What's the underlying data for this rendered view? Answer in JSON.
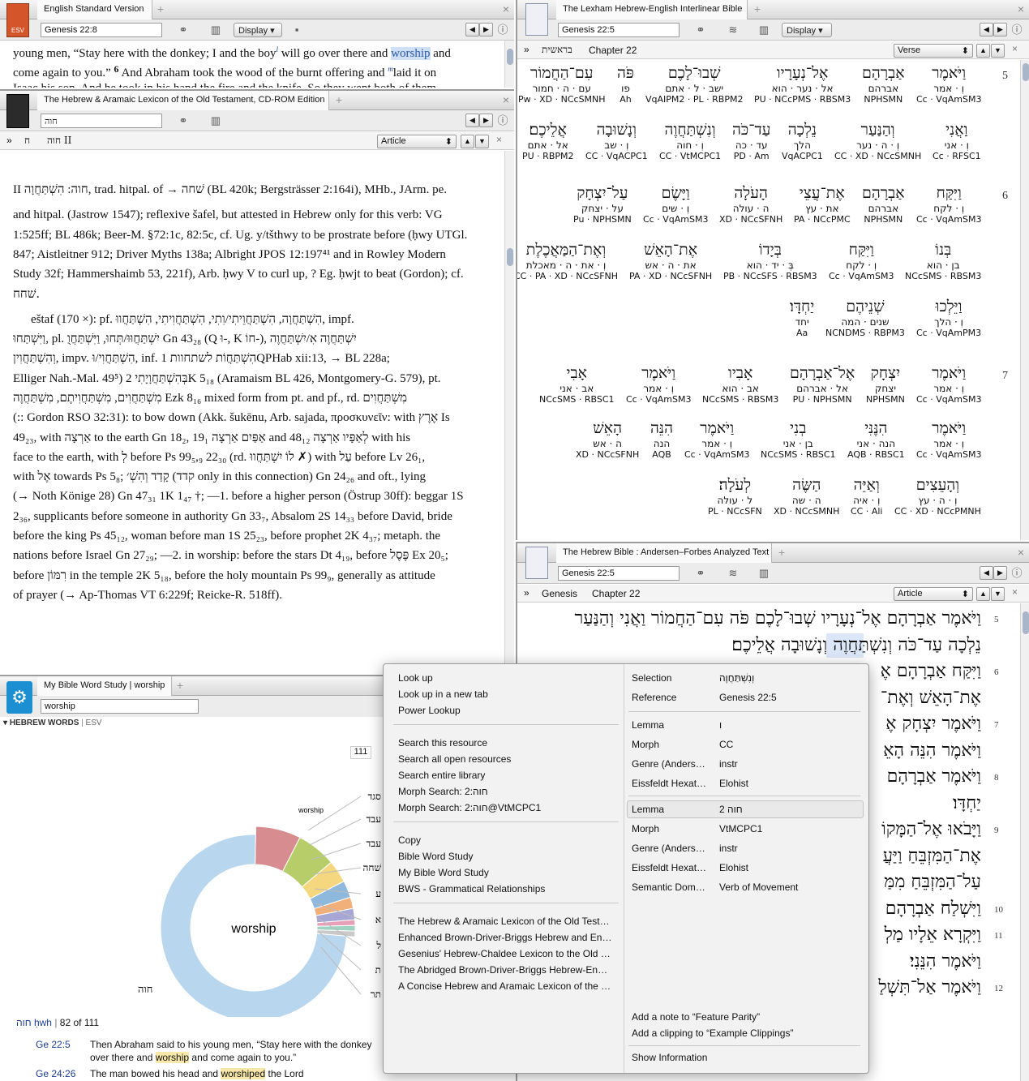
{
  "esv": {
    "tab": "English Standard Version",
    "ref": "Genesis 22:8",
    "display": "Display",
    "icon": "esv-logo-icon",
    "text1": "young men, “Stay here with the donkey; I and the boy",
    "sup_l": "l",
    "text1b": " will go over there and ",
    "hl": "worship",
    "text1c": " and",
    "text2": "come again to you.” ",
    "vn6": "6",
    "text2b": " And Abraham took the wood of the burnt offering and ",
    "sup_m": "m",
    "text2c": "laid it on",
    "text3": "Isaac his son. And he took in his hand the fire and the knife. So they went both of them"
  },
  "halot": {
    "tab": "The Hebrew & Aramaic Lexicon of the Old Testament, CD-ROM Edition",
    "search": "חוה",
    "nav1": "ח",
    "nav2": "חוה II",
    "sel": "Article",
    "lines": [
      "II חוה: הִשְׁתַּחֲוָה, trad. hitpal. of → שׁחה (BL 420k; Bergsträsser 2:164i), MHb., JArm. pe.",
      "and hitpal. (Jastrow 1547); reflexive šafel, but attested in Hebrew only for this verb: VG",
      "1:525ff; BL 486k; Beer-M. §72:1c, 82:5c, cf. Ug. y/tšthwy to be prostrate before (ḥwy UTGl.",
      "847; Aistleitner 912; Driver Myths 138a; Albright JPOS 12:197⁴¹ and in Rowley Modern",
      "Study 32f; Hammershaimb 53, 221f), Arb. ḥwy V to curl up, ? Eg. ḥwjt to beat (Gordon); cf.",
      "שׁחח.",
      "eštaf (170 ×): pf. הִשְׁתַּחֲוָה, הִשְׁתַּחֲוֵיתִי/וִתִי, הִשְׁתַּחֲוִיתִי, הִשְׁתַּחֲווּ, impf.",
      "וַיִּשְׁתַּחוּ, pl. יִשְׁתַּחֲוּוּ/תְּחוּ, וַיִּשְׁתַּחֲוֻ Gn 43₂₈ (Q וּ-, K חוֹ-), יִשְׁתַּחֲוֶה אִ/יִשְׁתַּחֲוֶה",
      "וְהִשְׁתַּחֲוִין, impv. הִשְׁתַּחֲוִי/וּ, inf. הִשְׁתַּחֲוֹת לשתחוות 1QPHab xii:13, → BL 228a;",
      "Elliger Nah.-Mal. 49⁵) בְּהִשְׁתַּחֲוָיָתִי 2K 5₁₈ (Aramaism BL 426, Montgomery-G. 579), pt.",
      "מִשְׁתַּחֲוִים, מִשְׁתַּחֲוִיתֶם, מִשְׁתַּחֲוֶה Ezk 8₁₆ mixed form from pt. and pf., rd. מִשְׁתַּחֲוִים",
      "(:: Gordon RSO 32:31): to bow down (Akk. šukēnu, Arb. sajada, προσκυνεῖν: with אֶרֶץ Is",
      "49₂₃, with אַרְצָה to the earth Gn 18₂, אַפַּיִם אַרְצָה 19₁ and לְאַפָּיו אַרְצָה 48₁₂ with his",
      "face to the earth, with לְ before Ps 99₅,₉ 22₃₀ (rd. לוֹ יִשְׁתַּחֲווּ ✗) with עַל before Lv 26₁,",
      "with אֶל towards Ps 5₈; קדד) קָדַד וְהִשְׁ׳ only in this connection) Gn 24₂₆ and oft., lying",
      "(→ Noth Könige 28) Gn 47₃₁ 1K 1₄₇ †; —1. before a higher person (Östrup 30ff): beggar 1S",
      "2₃₆, supplicants before someone in authority Gn 33₇, Absalom 2S 14₃₃ before David, bride",
      "before the king Ps 45₁₂, woman before man 1S 25₂₃, before prophet 2K 4₃₇; metaph. the",
      "nations before Israel Gn 27₂₉; —2. in worship: before the stars Dt 4₁₉, before פֶּסֶל Ex 20₅;",
      "before רִמּוֹן in the temple 2K 5₁₈, before the holy mountain Ps 99₉, generally as attitude",
      "of prayer (→ Ap-Thomas VT 6:229f; Reicke-R. 518ff)."
    ]
  },
  "lhi": {
    "tab": "The Lexham Hebrew-English Interlinear Bible",
    "ref": "Genesis 22:5",
    "display": "Display",
    "nav1": "בראשית",
    "nav2": "Chapter 22",
    "sel": "Verse",
    "rows": [
      {
        "v": "5",
        "words": [
          [
            "וַיֹּאמֶר",
            "וְ · אמר",
            "Cc · VqAmSM3"
          ],
          [
            "אַבְרָהָם",
            "אברהם",
            "NPHSMN"
          ],
          [
            "אֶל־נְעָרָיו",
            "אל · נער · הוא",
            "PU · NCcPMS · RBSM3"
          ],
          [
            "שְׁבוּ־לָכֶם",
            "ישב · ל · אתם",
            "VqAIPM2 · PL · RBPM2"
          ],
          [
            "פֹּה",
            "פו",
            "Ah"
          ],
          [
            "עִם־הַחֲמוֹר",
            "עם · ה · חמור",
            "Pw · XD · NCcSMNH"
          ]
        ]
      },
      {
        "v": "",
        "words": [
          [
            "וַאֲנִי",
            "וְ · אני",
            "Cc · RFSC1"
          ],
          [
            "וְהַנַּעַר",
            "וְ · ה · נער",
            "CC · XD · NCcSMNH"
          ],
          [
            "נֵלְכָה",
            "הלך",
            "VqACPC1"
          ],
          [
            "עַד־כֹּה",
            "עד · כה",
            "PD · Am"
          ],
          [
            "וְנִשְׁתַּחֲוֶה",
            "וְ · חוה",
            "CC · VtMCPC1"
          ],
          [
            "וְנָשׁוּבָה",
            "וְ · שב",
            "CC · VqACPC1"
          ],
          [
            "אֲלֵיכֶם׃",
            "אל · אתם",
            "PU · RBPM2"
          ]
        ]
      },
      {
        "v": "6",
        "words": [
          [
            "וַיִּקַּח",
            "וְ · לקח",
            "Cc · VqAmSM3"
          ],
          [
            "אַבְרָהָם",
            "אברהם",
            "NPHSMN"
          ],
          [
            "אֶת־עֲצֵי",
            "את · עץ",
            "PA · NCcPMC"
          ],
          [
            "הָעֹלָה",
            "ה · עולה",
            "XD · NCcSFNH"
          ],
          [
            "וַיָּשֶׂם",
            "וְ · שים",
            "Cc · VqAmSM3"
          ],
          [
            "עַל־יִצְחָק",
            "על · יצחק",
            "Pu · NPHSMN"
          ]
        ]
      },
      {
        "v": "",
        "words": [
          [
            "בְּנוֹ",
            "בן · הוא",
            "NCcSMS · RBSM3"
          ],
          [
            "וַיִּקַּח",
            "וְ · לקח",
            "Cc · VqAmSM3"
          ],
          [
            "בְּיָדוֹ",
            "בְּ · יד · הוא",
            "PB · NCcSFS · RBSM3"
          ],
          [
            "אֶת־הָאֵשׁ",
            "את · ה · אש",
            "PA · XD · NCcSFNH"
          ],
          [
            "וְאֶת־הַמַּאֲכֶלֶת",
            "וְ · את · ה · מאכלת",
            "CC · PA · XD · NCcSFNH"
          ]
        ]
      },
      {
        "v": "",
        "words": [
          [
            "וַיֵּלְכוּ",
            "וְ · הלך",
            "Cc · VqAmPM3"
          ],
          [
            "שְׁנֵיהֶם",
            "שנים · המה",
            "NCNDMS · RBPM3"
          ],
          [
            "יַחְדָּו׃",
            "יחד",
            "Aa"
          ]
        ]
      },
      {
        "v": "7",
        "words": [
          [
            "וַיֹּאמֶר",
            "וְ · אמר",
            "Cc · VqAmSM3"
          ],
          [
            "יִצְחָק",
            "יצחק",
            "NPHSMN"
          ],
          [
            "אֶל־אַבְרָהָם",
            "אל · אברהם",
            "PU · NPHSMN"
          ],
          [
            "אָבִיו",
            "אב · הוא",
            "NCcSMS · RBSM3"
          ],
          [
            "וַיֹּאמֶר",
            "וְ · אמר",
            "Cc · VqAmSM3"
          ],
          [
            "אָבִי",
            "אב · אני",
            "NCcSMS · RBSC1"
          ]
        ]
      },
      {
        "v": "",
        "words": [
          [
            "וַיֹּאמֶר",
            "וְ · אמר",
            "Cc · VqAmSM3"
          ],
          [
            "הִנֶּנִּי",
            "הנה · אני",
            "AQB · RBSC1"
          ],
          [
            "בְנִי",
            "בן · אני",
            "NCcSMS · RBSC1"
          ],
          [
            "וַיֹּאמֶר",
            "וְ · אמר",
            "Cc · VqAmSM3"
          ],
          [
            "הִנֵּה",
            "הנה",
            "AQB"
          ],
          [
            "הָאֵשׁ",
            "ה · אש",
            "XD · NCcSFNH"
          ]
        ]
      },
      {
        "v": "",
        "words": [
          [
            "וְהָעֵצִים",
            "וְ · ה · עץ",
            "CC · XD · NCcPMNH"
          ],
          [
            "וְאַיֵּה",
            "וְ · איה",
            "CC · Ali"
          ],
          [
            "הַשֶּׂה",
            "ה · שה",
            "XD · NCcSMNH"
          ],
          [
            "לְעֹלָה׃",
            "ל · עולה",
            "PL · NCcSFN"
          ]
        ]
      }
    ]
  },
  "af": {
    "tab": "The Hebrew Bible : Andersen–Forbes Analyzed Text",
    "ref": "Genesis 22:5",
    "nav1": "Genesis",
    "nav2": "Chapter 22",
    "sel": "Article",
    "lines": [
      {
        "v": "5",
        "t": "וַיֹּאמֶר אַבְרָהָם אֶל־נְעָרָיו שְׁבוּ־לָכֶם פֹּה עִם־הַחֲמוֹר וַאֲנִי וְהַנַּעַר"
      },
      {
        "v": "",
        "t": "נֵלְכָה עַד־כֹּה וְנִשְׁתַּחֲוֶה וְנָשׁוּבָה אֲלֵיכֶם׃"
      },
      {
        "v": "6",
        "t": "וַיִּקַּח אַבְרָהָם אֶ"
      },
      {
        "v": "",
        "t": "אֶת־הָאֵשׁ וְאֶת־"
      },
      {
        "v": "7",
        "t": "וַיֹּאמֶר יִצְחָק אֶ"
      },
      {
        "v": "",
        "t": "וַיֹּאמֶר הִנֵּה הָאֵ"
      },
      {
        "v": "8",
        "t": "וַיֹּאמֶר אַבְרָהָם"
      },
      {
        "v": "",
        "t": "יַחְדָּו׃"
      },
      {
        "v": "9",
        "t": "וַיָּבֹאוּ אֶל־הַמָּקוֹ"
      },
      {
        "v": "",
        "t": "אֶת־הַמִּזְבֵּחַ וַיַּעֲ"
      },
      {
        "v": "",
        "t": "עַל־הַמִּזְבֵּחַ מִמַּ"
      },
      {
        "v": "10",
        "t": "וַיִּשְׁלַח אַבְרָהָם"
      },
      {
        "v": "11",
        "t": "וַיִּקְרָא אֵלָיו מַלְ"
      },
      {
        "v": "",
        "t": "וַיֹּאמֶר הִנֵּנִי׃"
      },
      {
        "v": "12",
        "t": "וַיֹּאמֶר אַל־תִּשְׁלַ"
      }
    ]
  },
  "ws": {
    "tab": "My Bible Word Study | worship",
    "search": "worship",
    "section": "HEBREW WORDS",
    "section2": "ESV",
    "center": "worship",
    "count_label": "111",
    "chart_data": {
      "type": "pie",
      "title": "worship",
      "series": [
        {
          "values": [
            82,
            8,
            7,
            4,
            3,
            2,
            2,
            1,
            1,
            1
          ]
        }
      ],
      "labels": [
        "חוה",
        "סגד",
        "עבד",
        "",
        "שׁחה",
        "",
        "",
        "אֶ",
        "",
        "תר"
      ]
    },
    "slice_labels": [
      {
        "t": "סגד",
        "s": "worship"
      },
      {
        "t": "עבד"
      },
      {
        "t": "עבד"
      },
      {
        "t": "שׁחה"
      },
      {
        "t": "ע"
      },
      {
        "t": "א"
      },
      {
        "t": "ל"
      },
      {
        "t": "ת"
      },
      {
        "t": "תר"
      }
    ],
    "big_label": "חוה",
    "lemma": "חוה ḥwh",
    "lemma_count": "82 of 111",
    "refs": [
      {
        "r": "Ge 22:5",
        "t1": "Then Abraham said to his young men, “Stay here with the donkey",
        "t2a": "over there and ",
        "hl": "worship",
        "t2b": " and come again to you.”"
      },
      {
        "r": "Ge 24:26",
        "t1a": "The man bowed his head and ",
        "hl": "worshiped",
        "t1b": " the Lord"
      }
    ]
  },
  "menu": {
    "group1": [
      "Look up",
      "Look up in a new tab",
      "Power Lookup"
    ],
    "group2": [
      "Search this resource",
      "Search all open resources",
      "Search entire library",
      "Morph Search: 2:חוה",
      "Morph Search: 2:חוה@VtMCPC1"
    ],
    "group3": [
      "Copy",
      "Bible Word Study",
      "My Bible Word Study",
      "BWS - Grammatical Relationships"
    ],
    "group4": [
      "The Hebrew & Aramaic Lexicon of the Old Test…",
      "Enhanced Brown-Driver-Briggs Hebrew and En…",
      "Gesenius' Hebrew-Chaldee Lexicon to the Old …",
      "The Abridged Brown-Driver-Briggs Hebrew-En…",
      "A Concise Hebrew and Aramaic Lexicon of the …"
    ],
    "kv1": [
      [
        "Selection",
        "וְנִשְׁתַּחֲוֶה"
      ],
      [
        "Reference",
        "Genesis 22:5"
      ]
    ],
    "kv2": [
      [
        "Lemma",
        "ו"
      ],
      [
        "Morph",
        "CC"
      ],
      [
        "Genre (Anders…",
        "instr"
      ],
      [
        "Eissfeldt Hexat…",
        "Elohist"
      ]
    ],
    "kv3": [
      [
        "Lemma",
        "חוה 2"
      ],
      [
        "Morph",
        "VtMCPC1"
      ],
      [
        "Genre (Anders…",
        "instr"
      ],
      [
        "Eissfeldt Hexat…",
        "Elohist"
      ],
      [
        "Semantic Dom…",
        "Verb of Movement"
      ]
    ],
    "note": "Add a note to “Feature Parity”",
    "clip": "Add a clipping to “Example Clippings”",
    "info": "Show Information"
  }
}
